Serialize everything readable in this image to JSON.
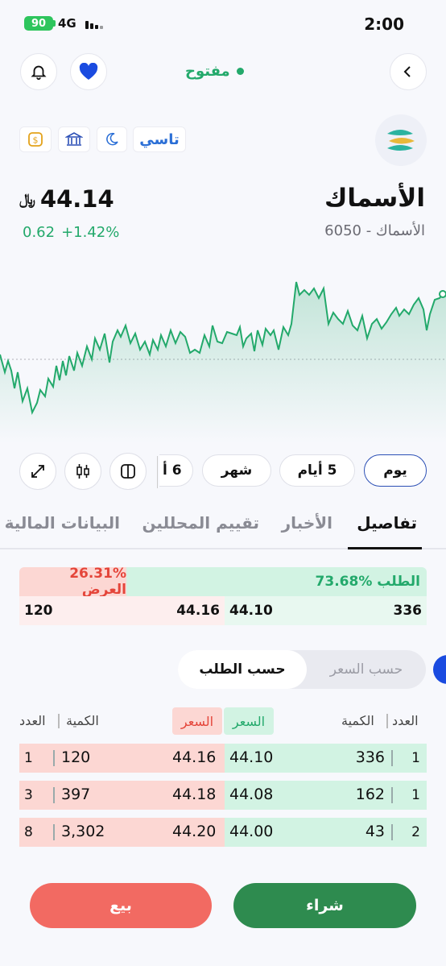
{
  "status_bar": {
    "battery": "90",
    "network": "4G",
    "time": "2:00"
  },
  "header": {
    "market_status": "مفتوح"
  },
  "tags": {
    "index": "تاسي"
  },
  "stock": {
    "name": "الأسماك",
    "subtitle": "الأسماك - 6050",
    "price": "44.14",
    "change": "0.62",
    "change_pct": "+1.42%"
  },
  "ranges": [
    "يوم",
    "5 أيام",
    "شهر",
    "6 أ"
  ],
  "tabs": [
    "تفاصيل",
    "الأخبار",
    "تقييم المحللين",
    "البيانات المالية"
  ],
  "depth": {
    "bid_label": "الطلب %73.68",
    "ask_label": "26.31% العرض",
    "bid_qty": "336",
    "bid_price": "44.10",
    "ask_price": "44.16",
    "ask_qty": "120"
  },
  "segment": {
    "by_order": "حسب الطلب",
    "by_price": "حسب السعر"
  },
  "book": {
    "headers": {
      "count": "العدد",
      "qty": "الكمية",
      "price": "السعر"
    },
    "rows": [
      {
        "bid_count": "1",
        "bid_qty": "336",
        "bid_price": "44.10",
        "ask_price": "44.16",
        "ask_qty": "120",
        "ask_count": "1"
      },
      {
        "bid_count": "1",
        "bid_qty": "162",
        "bid_price": "44.08",
        "ask_price": "44.18",
        "ask_qty": "397",
        "ask_count": "3"
      },
      {
        "bid_count": "2",
        "bid_qty": "43",
        "bid_price": "44.00",
        "ask_price": "44.20",
        "ask_qty": "3,302",
        "ask_count": "8"
      }
    ]
  },
  "actions": {
    "sell": "بيع",
    "buy": "شراء"
  },
  "colors": {
    "green": "#23a96b",
    "red": "#e4453a",
    "blue": "#1a4be0",
    "buy": "#2e8b4f",
    "sell": "#f26a62"
  }
}
